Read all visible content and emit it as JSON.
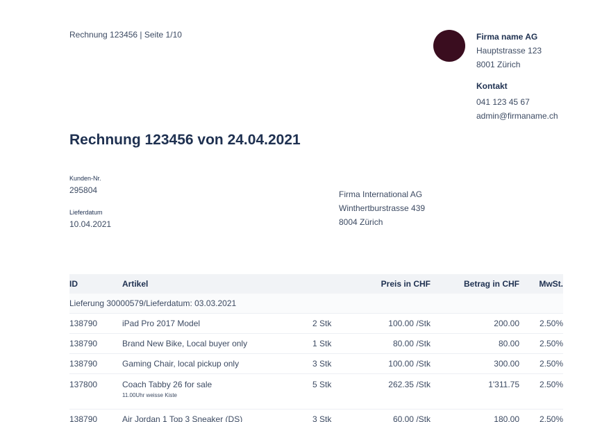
{
  "header": {
    "reference": "Rechnung 123456 | Seite 1/10"
  },
  "logo": {
    "color": "#3a0d1f"
  },
  "company": {
    "name": "Firma name AG",
    "street": "Hauptstrasse 123",
    "city": "8001 Zürich",
    "contact_title": "Kontakt",
    "phone": "041 123 45 67",
    "email": "admin@firmaname.ch"
  },
  "invoice": {
    "title": "Rechnung 123456 von 24.04.2021"
  },
  "meta": {
    "customer_label": "Kunden-Nr.",
    "customer_value": "295804",
    "delivery_label": "Lieferdatum",
    "delivery_value": "10.04.2021"
  },
  "recipient": {
    "name": "Firma International AG",
    "street": "Winthertburstrasse 439",
    "city": "8004 Zürich"
  },
  "table": {
    "headers": {
      "id": "ID",
      "article": "Artikel",
      "qty": "",
      "price": "Preis in CHF",
      "amount": "Betrag in CHF",
      "vat": "MwSt."
    },
    "delivery_line": "Lieferung 30000579/Lieferdatum: 03.03.2021",
    "rows": [
      {
        "id": "138790",
        "article": "iPad Pro 2017 Model",
        "note": "",
        "qty": "2 Stk",
        "price": "100.00 /Stk",
        "amount": "200.00",
        "vat": "2.50%"
      },
      {
        "id": "138790",
        "article": "Brand New Bike, Local buyer only",
        "note": "",
        "qty": "1 Stk",
        "price": "80.00 /Stk",
        "amount": "80.00",
        "vat": "2.50%"
      },
      {
        "id": "138790",
        "article": "Gaming Chair, local pickup only",
        "note": "",
        "qty": "3 Stk",
        "price": "100.00 /Stk",
        "amount": "300.00",
        "vat": "2.50%"
      },
      {
        "id": "137800",
        "article": "Coach Tabby 26 for sale",
        "note": "11.00Uhr weisse Kiste",
        "qty": "5 Stk",
        "price": "262.35 /Stk",
        "amount": "1'311.75",
        "vat": "2.50%"
      },
      {
        "id": "138790",
        "article": "Air Jordan 1 Top 3 Sneaker (DS)",
        "note": "",
        "qty": "3 Stk",
        "price": "60.00 /Stk",
        "amount": "180.00",
        "vat": "2.50%"
      }
    ]
  }
}
